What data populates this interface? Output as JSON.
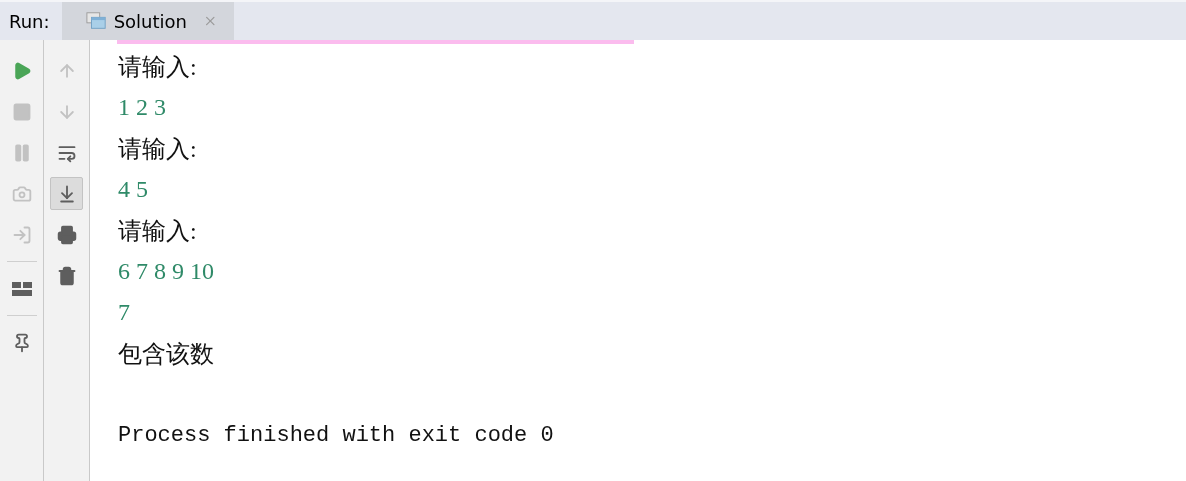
{
  "run_bar": {
    "label": "Run:",
    "tabs": [
      {
        "label": "Solution",
        "selected": true
      }
    ]
  },
  "left_toolbar": [
    {
      "kind": "play",
      "disabled": false
    },
    {
      "kind": "stop",
      "disabled": true
    },
    {
      "kind": "pause",
      "disabled": true
    },
    {
      "kind": "camera",
      "disabled": true
    },
    {
      "kind": "exit",
      "disabled": true
    },
    {
      "kind": "separator"
    },
    {
      "kind": "layout",
      "disabled": false
    },
    {
      "kind": "separator"
    },
    {
      "kind": "pin",
      "disabled": false
    }
  ],
  "right_toolbar": [
    {
      "kind": "up",
      "disabled": true,
      "selected": false
    },
    {
      "kind": "down",
      "disabled": true,
      "selected": false
    },
    {
      "kind": "wrap",
      "disabled": false,
      "selected": false
    },
    {
      "kind": "scroll-end",
      "disabled": false,
      "selected": true
    },
    {
      "kind": "print",
      "disabled": false,
      "selected": false
    },
    {
      "kind": "trash",
      "disabled": false,
      "selected": false
    }
  ],
  "console": [
    {
      "kind": "output",
      "text": "请输入:"
    },
    {
      "kind": "input",
      "text": "1 2 3"
    },
    {
      "kind": "output",
      "text": "请输入:"
    },
    {
      "kind": "input",
      "text": "4 5"
    },
    {
      "kind": "output",
      "text": "请输入:"
    },
    {
      "kind": "input",
      "text": "6 7 8 9 10"
    },
    {
      "kind": "input",
      "text": "7"
    },
    {
      "kind": "output",
      "text": "包含该数"
    },
    {
      "kind": "system",
      "text": "Process finished with exit code 0"
    }
  ]
}
